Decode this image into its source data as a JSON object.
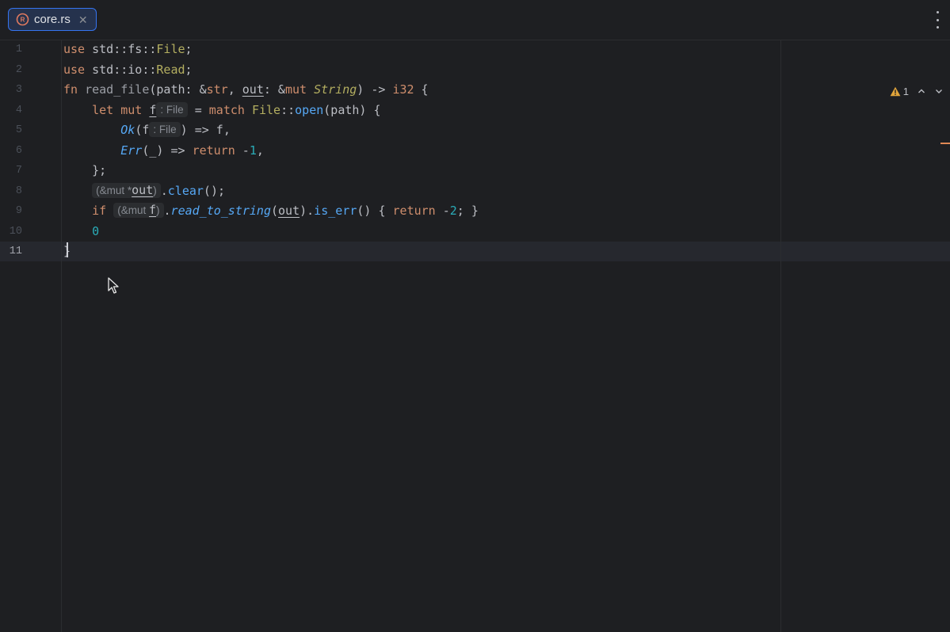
{
  "tab": {
    "label": "core.rs",
    "icon": "rust-file-icon",
    "close_icon": "close-icon"
  },
  "header": {
    "more_icon": "vertical-dots-icon"
  },
  "inspections": {
    "warning_count": "1",
    "icon": "warning-icon"
  },
  "line_numbers": [
    "1",
    "2",
    "3",
    "4",
    "5",
    "6",
    "7",
    "8",
    "9",
    "10",
    "11"
  ],
  "current_line": "11",
  "code": {
    "l1": {
      "kw": "use",
      "path": " std::fs::",
      "ty": "File",
      "end": ";"
    },
    "l2": {
      "kw": "use",
      "path": " std::io::",
      "ty": "Read",
      "end": ";"
    },
    "l3": {
      "kw": "fn",
      "name": " read_file",
      "p1": "(path: &",
      "t1": "str",
      "p2": ", ",
      "out": "out",
      "p3": ": &",
      "kw2": "mut",
      "p4": " ",
      "t2": "String",
      "p5": ") -> ",
      "t3": "i32",
      "p6": " {"
    },
    "l4": {
      "indent": "    ",
      "kw": "let mut",
      "sp": " ",
      "f": "f",
      "hint": ": File",
      "p1": " = ",
      "kw2": "match",
      "sp2": " ",
      "ty": "File",
      "p2": "::",
      "fn": "open",
      "p3": "(path) {"
    },
    "l5": {
      "indent": "        ",
      "it": "Ok",
      "p1": "(f",
      "hint": ": File",
      "p2": ") => f,"
    },
    "l6": {
      "indent": "        ",
      "it": "Err",
      "p1": "(_) => ",
      "kw": "return",
      "p2": " -",
      "num": "1",
      "p3": ","
    },
    "l7": {
      "indent": "    ",
      "text": "};"
    },
    "l8": {
      "indent": "    ",
      "hint_pre": "(&mut *",
      "hint_var": "out",
      "hint_post": ")",
      "p1": ".",
      "fn": "clear",
      "p2": "();"
    },
    "l9": {
      "indent": "    ",
      "kw": "if",
      "sp": " ",
      "hint_pre": "(&mut ",
      "hint_var": "f",
      "hint_post": ")",
      "p1": ".",
      "fn": "read_to_string",
      "p2": "(",
      "out": "out",
      "p3": ").",
      "fn2": "is_err",
      "p4": "() { ",
      "kw2": "return",
      "p5": " -",
      "num": "2",
      "p6": "; }"
    },
    "l10": {
      "indent": "    ",
      "num": "0"
    },
    "l11": {
      "text": "}"
    }
  },
  "colors": {
    "keyword": "#cf8e6d",
    "type": "#b3ae60",
    "function": "#56a8f5",
    "number": "#2aacb8",
    "accent": "#3574f0",
    "warning": "#e0a43b"
  }
}
